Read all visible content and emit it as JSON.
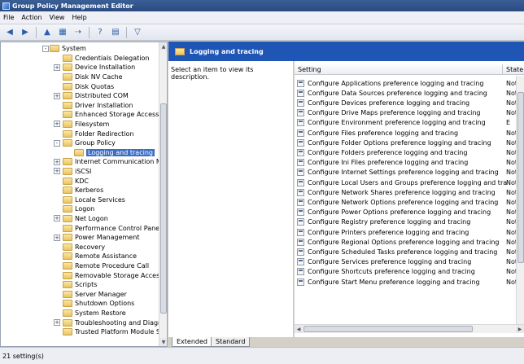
{
  "window": {
    "title": "Group Policy Management Editor"
  },
  "menu": [
    "File",
    "Action",
    "View",
    "Help"
  ],
  "toolbar_icons": [
    "back-arrow-icon",
    "forward-arrow-icon",
    "up-folder-icon",
    "show-hide-tree-icon",
    "export-list-icon",
    "help-icon",
    "properties-icon",
    "filter-icon"
  ],
  "tree": {
    "items": [
      {
        "label": "System",
        "level": 0,
        "expander": "-"
      },
      {
        "label": "Credentials Delegation",
        "level": 1,
        "expander": ""
      },
      {
        "label": "Device Installation",
        "level": 1,
        "expander": "+"
      },
      {
        "label": "Disk NV Cache",
        "level": 1,
        "expander": ""
      },
      {
        "label": "Disk Quotas",
        "level": 1,
        "expander": ""
      },
      {
        "label": "Distributed COM",
        "level": 1,
        "expander": "+"
      },
      {
        "label": "Driver Installation",
        "level": 1,
        "expander": ""
      },
      {
        "label": "Enhanced Storage Access",
        "level": 1,
        "expander": ""
      },
      {
        "label": "Filesystem",
        "level": 1,
        "expander": "+"
      },
      {
        "label": "Folder Redirection",
        "level": 1,
        "expander": ""
      },
      {
        "label": "Group Policy",
        "level": 1,
        "expander": "-"
      },
      {
        "label": "Logging and tracing",
        "level": 2,
        "expander": "",
        "selected": true
      },
      {
        "label": "Internet Communication Mana",
        "level": 1,
        "expander": "+"
      },
      {
        "label": "iSCSI",
        "level": 1,
        "expander": "+"
      },
      {
        "label": "KDC",
        "level": 1,
        "expander": ""
      },
      {
        "label": "Kerberos",
        "level": 1,
        "expander": ""
      },
      {
        "label": "Locale Services",
        "level": 1,
        "expander": ""
      },
      {
        "label": "Logon",
        "level": 1,
        "expander": ""
      },
      {
        "label": "Net Logon",
        "level": 1,
        "expander": "+"
      },
      {
        "label": "Performance Control Panel",
        "level": 1,
        "expander": ""
      },
      {
        "label": "Power Management",
        "level": 1,
        "expander": "+"
      },
      {
        "label": "Recovery",
        "level": 1,
        "expander": ""
      },
      {
        "label": "Remote Assistance",
        "level": 1,
        "expander": ""
      },
      {
        "label": "Remote Procedure Call",
        "level": 1,
        "expander": ""
      },
      {
        "label": "Removable Storage Access",
        "level": 1,
        "expander": ""
      },
      {
        "label": "Scripts",
        "level": 1,
        "expander": ""
      },
      {
        "label": "Server Manager",
        "level": 1,
        "expander": ""
      },
      {
        "label": "Shutdown Options",
        "level": 1,
        "expander": ""
      },
      {
        "label": "System Restore",
        "level": 1,
        "expander": ""
      },
      {
        "label": "Troubleshooting and Diagnos",
        "level": 1,
        "expander": "+"
      },
      {
        "label": "Trusted Platform Module Serv",
        "level": 1,
        "expander": ""
      }
    ]
  },
  "right": {
    "header": "Logging and tracing",
    "description": "Select an item to view its description."
  },
  "list": {
    "columns": [
      "Setting",
      "State"
    ],
    "rows": [
      {
        "setting": "Configure Applications preference logging and tracing",
        "state": "Not"
      },
      {
        "setting": "Configure Data Sources preference logging and tracing",
        "state": "Not"
      },
      {
        "setting": "Configure Devices preference logging and tracing",
        "state": "Not"
      },
      {
        "setting": "Configure Drive Maps preference logging and tracing",
        "state": "Not"
      },
      {
        "setting": "Configure Environment preference logging and tracing",
        "state": "E"
      },
      {
        "setting": "Configure Files preference logging and tracing",
        "state": "Not"
      },
      {
        "setting": "Configure Folder Options preference logging and tracing",
        "state": "Not"
      },
      {
        "setting": "Configure Folders preference logging and tracing",
        "state": "Not"
      },
      {
        "setting": "Configure Ini Files preference logging and tracing",
        "state": "Not"
      },
      {
        "setting": "Configure Internet Settings preference logging and tracing",
        "state": "Not"
      },
      {
        "setting": "Configure Local Users and Groups preference logging and tracing",
        "state": "Not"
      },
      {
        "setting": "Configure Network Shares preference logging and tracing",
        "state": "Not"
      },
      {
        "setting": "Configure Network Options preference logging and tracing",
        "state": "Not"
      },
      {
        "setting": "Configure Power Options preference logging and tracing",
        "state": "Not"
      },
      {
        "setting": "Configure Registry preference logging and tracing",
        "state": "Not"
      },
      {
        "setting": "Configure Printers preference logging and tracing",
        "state": "Not"
      },
      {
        "setting": "Configure Regional Options preference logging and tracing",
        "state": "Not"
      },
      {
        "setting": "Configure Scheduled Tasks preference logging and tracing",
        "state": "Not"
      },
      {
        "setting": "Configure Services preference logging and tracing",
        "state": "Not"
      },
      {
        "setting": "Configure Shortcuts preference logging and tracing",
        "state": "Not"
      },
      {
        "setting": "Configure Start Menu preference logging and tracing",
        "state": "Not"
      }
    ]
  },
  "tabs": [
    "Extended",
    "Standard"
  ],
  "status": {
    "text": "21 setting(s)"
  }
}
